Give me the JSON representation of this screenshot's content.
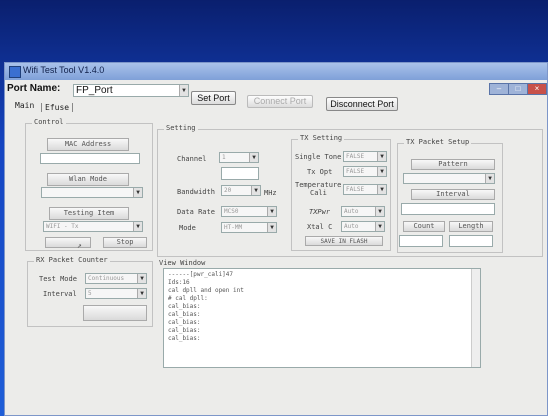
{
  "window": {
    "title": "Wifi Test Tool V1.4.0"
  },
  "port": {
    "label": "Port Name:",
    "value": "FP_Port",
    "set": "Set Port",
    "connect": "Connect Port",
    "disconnect": "Disconnect Port"
  },
  "tabs": [
    "Main",
    "Efuse"
  ],
  "control": {
    "title": "Control",
    "mac_label": "MAC Address",
    "wlan_label": "Wlan Mode",
    "testing_label": "Testing Item",
    "testing_value": "WIFI - Tx",
    "stop": "Stop"
  },
  "rx": {
    "title": "RX Packet Counter",
    "test_mode_label": "Test Mode",
    "test_mode_value": "Continuous",
    "interval_label": "Interval",
    "interval_value": "5"
  },
  "setting": {
    "title": "Setting",
    "channel_label": "Channel",
    "channel_value": "1",
    "bandwidth_label": "Bandwidth",
    "bandwidth_value": "20",
    "bandwidth_unit": "MHz",
    "data_rate_label": "Data Rate",
    "data_rate_value": "MCS0",
    "mode_label": "Mode",
    "mode_value": "HT-MM"
  },
  "tx": {
    "title": "TX Setting",
    "single_tone_label": "Single Tone",
    "single_tone_value": "FALSE",
    "tx_opt_label": "Tx Opt",
    "tx_opt_value": "FALSE",
    "temp_label1": "Temperature",
    "temp_label2": "Cali",
    "temp_value": "FALSE",
    "txpwr_label": "TXPwr",
    "txpwr_value": "Auto",
    "xtal_label": "Xtal C",
    "xtal_value": "Auto",
    "save": "SAVE IN FLASH"
  },
  "pkt": {
    "title": "TX Packet Setup",
    "pattern": "Pattern",
    "interval": "Interval",
    "count": "Count",
    "length": "Length"
  },
  "view": {
    "title": "View Window",
    "lines": [
      "------[pwr_cali]47",
      "Ids:16",
      "cal dpll and open int",
      "",
      "# cal dpll:",
      "cal_bias:",
      "cal_bias:",
      "cal_bias:",
      "cal_bias:",
      "cal_bias:"
    ]
  }
}
